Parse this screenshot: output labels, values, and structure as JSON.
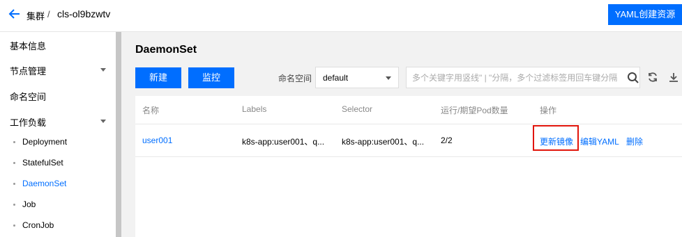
{
  "header": {
    "breadcrumb_parent": "集群",
    "breadcrumb_sep": "/",
    "breadcrumb_current": "cls-ol9bzwtv",
    "yaml_button": "YAML创建资源"
  },
  "sidebar": {
    "items": [
      {
        "label": "基本信息",
        "expandable": false
      },
      {
        "label": "节点管理",
        "expandable": true
      },
      {
        "label": "命名空间",
        "expandable": false
      },
      {
        "label": "工作负载",
        "expandable": true
      }
    ],
    "workload_sub_items": [
      {
        "label": "Deployment",
        "active": false
      },
      {
        "label": "StatefulSet",
        "active": false
      },
      {
        "label": "DaemonSet",
        "active": true
      },
      {
        "label": "Job",
        "active": false
      },
      {
        "label": "CronJob",
        "active": false
      }
    ]
  },
  "main": {
    "title": "DaemonSet",
    "new_button": "新建",
    "monitor_button": "监控",
    "namespace_label": "命名空间",
    "namespace_value": "default",
    "search_placeholder": "多个关键字用竖线\" | \"分隔，多个过滤标签用回车键分隔"
  },
  "table": {
    "columns": [
      "名称",
      "Labels",
      "Selector",
      "运行/期望Pod数量",
      "操作"
    ],
    "rows": [
      {
        "name": "user001",
        "labels": "k8s-app:user001、q...",
        "selector": "k8s-app:user001、q...",
        "pods": "2/2",
        "actions": [
          "更新镜像",
          "编辑YAML",
          "删除"
        ]
      }
    ]
  },
  "colors": {
    "accent": "#006eff",
    "highlight": "#e1140a",
    "main_bg": "#f2f2f2"
  },
  "icons": [
    "back-arrow-icon",
    "chevron-down-icon",
    "search-icon",
    "refresh-icon",
    "download-icon"
  ]
}
